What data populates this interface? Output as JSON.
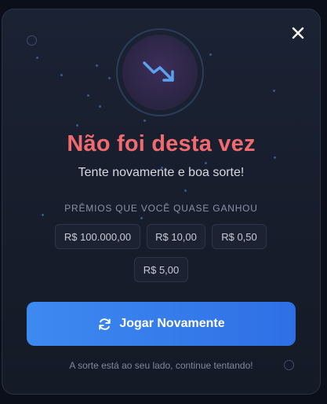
{
  "modal": {
    "title": "Não foi desta vez",
    "subtitle": "Tente novamente e boa sorte!",
    "prizes_heading": "PRÊMIOS QUE VOCÊ QUASE GANHOU",
    "prizes": [
      "R$ 100.000,00",
      "R$ 10,00",
      "R$ 0,50",
      "R$ 5,00"
    ],
    "play_button_label": "Jogar Novamente",
    "footer_text": "A sorte está ao seu lado, continue tentando!",
    "icons": {
      "main": "trending-down-icon",
      "close": "close-icon",
      "play": "refresh-icon"
    },
    "colors": {
      "title": "#f06a6f",
      "button": "#3d8af0",
      "background": "#1b2233"
    }
  }
}
